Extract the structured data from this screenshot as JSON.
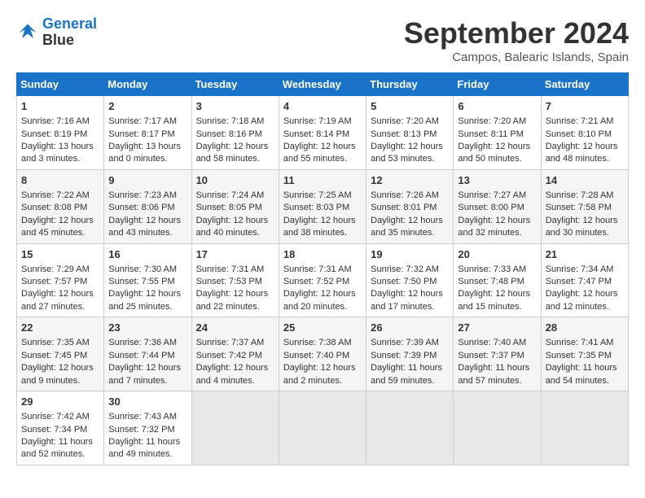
{
  "header": {
    "logo_line1": "General",
    "logo_line2": "Blue",
    "month_title": "September 2024",
    "location": "Campos, Balearic Islands, Spain"
  },
  "calendar": {
    "days_of_week": [
      "Sunday",
      "Monday",
      "Tuesday",
      "Wednesday",
      "Thursday",
      "Friday",
      "Saturday"
    ],
    "weeks": [
      [
        {
          "day": "",
          "empty": true
        },
        {
          "day": "",
          "empty": true
        },
        {
          "day": "",
          "empty": true
        },
        {
          "day": "",
          "empty": true
        },
        {
          "day": "",
          "empty": true
        },
        {
          "day": "",
          "empty": true
        },
        {
          "day": "",
          "empty": true
        }
      ]
    ],
    "cells": [
      {
        "day": "1",
        "sunrise": "7:16 AM",
        "sunset": "8:19 PM",
        "daylight": "13 hours and 3 minutes."
      },
      {
        "day": "2",
        "sunrise": "7:17 AM",
        "sunset": "8:17 PM",
        "daylight": "13 hours and 0 minutes."
      },
      {
        "day": "3",
        "sunrise": "7:18 AM",
        "sunset": "8:16 PM",
        "daylight": "12 hours and 58 minutes."
      },
      {
        "day": "4",
        "sunrise": "7:19 AM",
        "sunset": "8:14 PM",
        "daylight": "12 hours and 55 minutes."
      },
      {
        "day": "5",
        "sunrise": "7:20 AM",
        "sunset": "8:13 PM",
        "daylight": "12 hours and 53 minutes."
      },
      {
        "day": "6",
        "sunrise": "7:20 AM",
        "sunset": "8:11 PM",
        "daylight": "12 hours and 50 minutes."
      },
      {
        "day": "7",
        "sunrise": "7:21 AM",
        "sunset": "8:10 PM",
        "daylight": "12 hours and 48 minutes."
      },
      {
        "day": "8",
        "sunrise": "7:22 AM",
        "sunset": "8:08 PM",
        "daylight": "12 hours and 45 minutes."
      },
      {
        "day": "9",
        "sunrise": "7:23 AM",
        "sunset": "8:06 PM",
        "daylight": "12 hours and 43 minutes."
      },
      {
        "day": "10",
        "sunrise": "7:24 AM",
        "sunset": "8:05 PM",
        "daylight": "12 hours and 40 minutes."
      },
      {
        "day": "11",
        "sunrise": "7:25 AM",
        "sunset": "8:03 PM",
        "daylight": "12 hours and 38 minutes."
      },
      {
        "day": "12",
        "sunrise": "7:26 AM",
        "sunset": "8:01 PM",
        "daylight": "12 hours and 35 minutes."
      },
      {
        "day": "13",
        "sunrise": "7:27 AM",
        "sunset": "8:00 PM",
        "daylight": "12 hours and 32 minutes."
      },
      {
        "day": "14",
        "sunrise": "7:28 AM",
        "sunset": "7:58 PM",
        "daylight": "12 hours and 30 minutes."
      },
      {
        "day": "15",
        "sunrise": "7:29 AM",
        "sunset": "7:57 PM",
        "daylight": "12 hours and 27 minutes."
      },
      {
        "day": "16",
        "sunrise": "7:30 AM",
        "sunset": "7:55 PM",
        "daylight": "12 hours and 25 minutes."
      },
      {
        "day": "17",
        "sunrise": "7:31 AM",
        "sunset": "7:53 PM",
        "daylight": "12 hours and 22 minutes."
      },
      {
        "day": "18",
        "sunrise": "7:31 AM",
        "sunset": "7:52 PM",
        "daylight": "12 hours and 20 minutes."
      },
      {
        "day": "19",
        "sunrise": "7:32 AM",
        "sunset": "7:50 PM",
        "daylight": "12 hours and 17 minutes."
      },
      {
        "day": "20",
        "sunrise": "7:33 AM",
        "sunset": "7:48 PM",
        "daylight": "12 hours and 15 minutes."
      },
      {
        "day": "21",
        "sunrise": "7:34 AM",
        "sunset": "7:47 PM",
        "daylight": "12 hours and 12 minutes."
      },
      {
        "day": "22",
        "sunrise": "7:35 AM",
        "sunset": "7:45 PM",
        "daylight": "12 hours and 9 minutes."
      },
      {
        "day": "23",
        "sunrise": "7:36 AM",
        "sunset": "7:44 PM",
        "daylight": "12 hours and 7 minutes."
      },
      {
        "day": "24",
        "sunrise": "7:37 AM",
        "sunset": "7:42 PM",
        "daylight": "12 hours and 4 minutes."
      },
      {
        "day": "25",
        "sunrise": "7:38 AM",
        "sunset": "7:40 PM",
        "daylight": "12 hours and 2 minutes."
      },
      {
        "day": "26",
        "sunrise": "7:39 AM",
        "sunset": "7:39 PM",
        "daylight": "11 hours and 59 minutes."
      },
      {
        "day": "27",
        "sunrise": "7:40 AM",
        "sunset": "7:37 PM",
        "daylight": "11 hours and 57 minutes."
      },
      {
        "day": "28",
        "sunrise": "7:41 AM",
        "sunset": "7:35 PM",
        "daylight": "11 hours and 54 minutes."
      },
      {
        "day": "29",
        "sunrise": "7:42 AM",
        "sunset": "7:34 PM",
        "daylight": "11 hours and 52 minutes."
      },
      {
        "day": "30",
        "sunrise": "7:43 AM",
        "sunset": "7:32 PM",
        "daylight": "11 hours and 49 minutes."
      }
    ]
  }
}
